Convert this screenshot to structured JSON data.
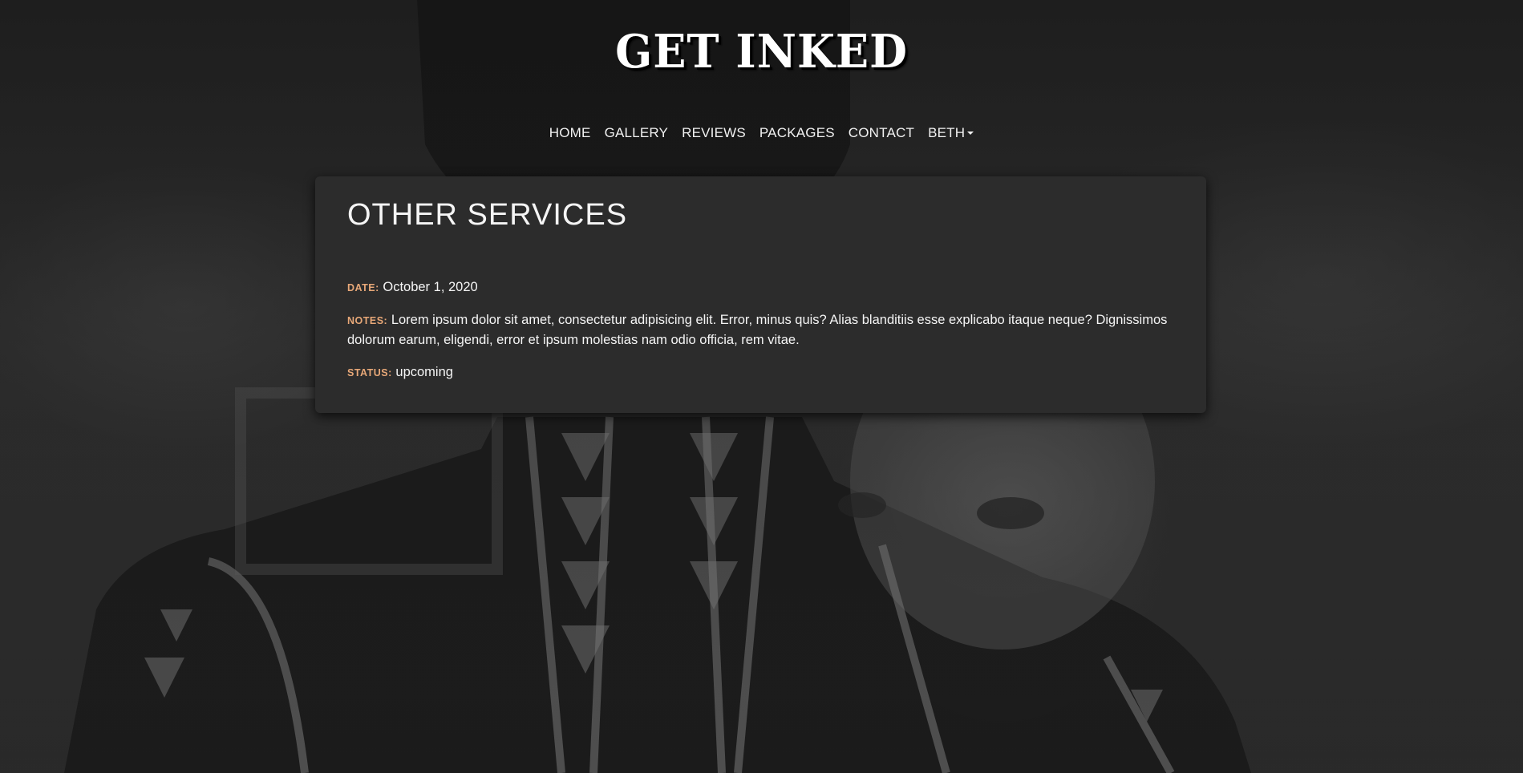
{
  "site": {
    "logo": "GET INKED"
  },
  "nav": {
    "items": [
      {
        "label": "HOME"
      },
      {
        "label": "GALLERY"
      },
      {
        "label": "REVIEWS"
      },
      {
        "label": "PACKAGES"
      },
      {
        "label": "CONTACT"
      }
    ],
    "user_menu": {
      "label": "BETH"
    }
  },
  "appointment": {
    "title": "OTHER SERVICES",
    "date_label": "DATE:",
    "date": "October 1, 2020",
    "notes_label": "NOTES:",
    "notes": "Lorem ipsum dolor sit amet, consectetur adipisicing elit. Error, minus quis? Alias blanditiis esse explicabo itaque neque? Dignissimos dolorum earum, eligendi, error et ipsum molestias nam odio officia, rem vitae.",
    "status_label": "STATUS:",
    "status": "upcoming"
  },
  "colors": {
    "label_accent": "#e8a878",
    "card_bg": "#2c2c2c"
  }
}
